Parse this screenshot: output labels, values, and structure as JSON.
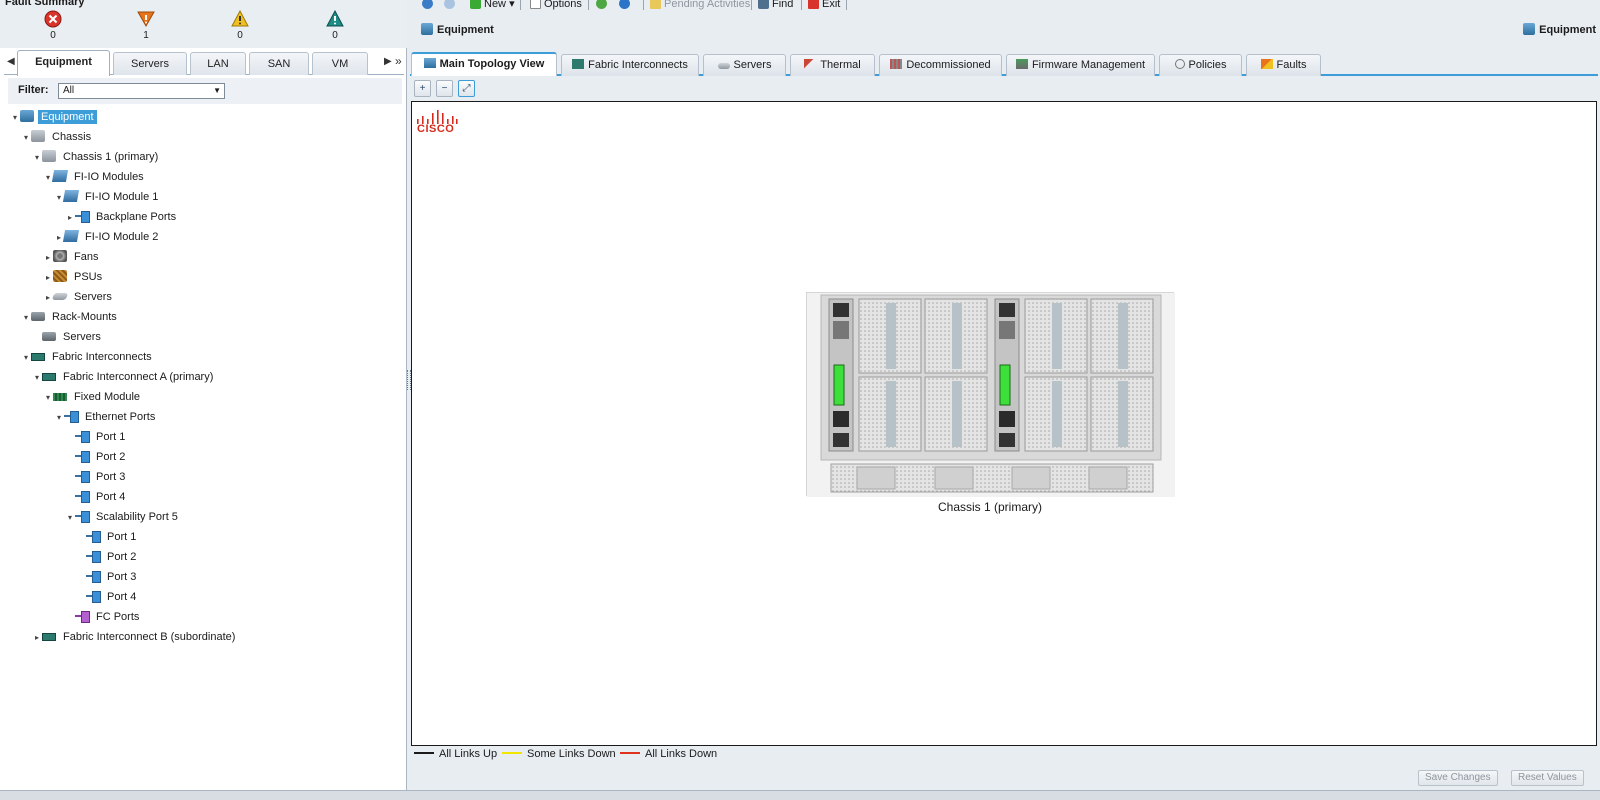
{
  "fault_summary": {
    "title": "Fault Summary",
    "critical": {
      "icon": "critical-x-icon",
      "count": "0",
      "color": "#d9342b"
    },
    "major": {
      "icon": "major-down-triangle-icon",
      "count": "1",
      "color": "#e8731b"
    },
    "minor": {
      "icon": "minor-warning-icon",
      "count": "0",
      "color": "#f0c020"
    },
    "warning": {
      "icon": "warning-teal-icon",
      "count": "0",
      "color": "#1f8b86"
    }
  },
  "nav": {
    "tabs": [
      "Equipment",
      "Servers",
      "LAN",
      "SAN",
      "VM"
    ],
    "active": "Equipment",
    "more_glyph": "»"
  },
  "filter": {
    "label": "Filter:",
    "value": "All"
  },
  "tree": [
    {
      "label": "Equipment",
      "icon": "equipment-icon",
      "twisty": "open",
      "selected": true
    },
    {
      "label": "Chassis",
      "icon": "chassis-icon",
      "twisty": "open"
    },
    {
      "label": "Chassis 1 (primary)",
      "icon": "chassis-icon",
      "twisty": "open"
    },
    {
      "label": "FI-IO Modules",
      "icon": "io-module-icon",
      "twisty": "open"
    },
    {
      "label": "FI-IO Module 1",
      "icon": "io-module-icon",
      "twisty": "open"
    },
    {
      "label": "Backplane Ports",
      "icon": "port-icon",
      "twisty": "closed"
    },
    {
      "label": "FI-IO Module 2",
      "icon": "io-module-icon",
      "twisty": "closed"
    },
    {
      "label": "Fans",
      "icon": "fan-icon",
      "twisty": "closed"
    },
    {
      "label": "PSUs",
      "icon": "psu-icon",
      "twisty": "closed"
    },
    {
      "label": "Servers",
      "icon": "server-icon",
      "twisty": "closed"
    },
    {
      "label": "Rack-Mounts",
      "icon": "rack-icon",
      "twisty": "open"
    },
    {
      "label": "Servers",
      "icon": "rack-icon",
      "twisty": "none"
    },
    {
      "label": "Fabric Interconnects",
      "icon": "fabric-interconnect-icon",
      "twisty": "open"
    },
    {
      "label": "Fabric Interconnect A (primary)",
      "icon": "fabric-interconnect-icon",
      "twisty": "open"
    },
    {
      "label": "Fixed Module",
      "icon": "fixed-module-icon",
      "twisty": "open"
    },
    {
      "label": "Ethernet Ports",
      "icon": "port-icon",
      "twisty": "open"
    },
    {
      "label": "Port 1",
      "icon": "port-icon",
      "twisty": "none"
    },
    {
      "label": "Port 2",
      "icon": "port-icon",
      "twisty": "none"
    },
    {
      "label": "Port 3",
      "icon": "port-icon",
      "twisty": "none"
    },
    {
      "label": "Port 4",
      "icon": "port-icon",
      "twisty": "none"
    },
    {
      "label": "Scalability Port 5",
      "icon": "port-icon",
      "twisty": "open"
    },
    {
      "label": "Port 1",
      "icon": "port-icon",
      "twisty": "none"
    },
    {
      "label": "Port 2",
      "icon": "port-icon",
      "twisty": "none"
    },
    {
      "label": "Port 3",
      "icon": "port-icon",
      "twisty": "none"
    },
    {
      "label": "Port 4",
      "icon": "port-icon",
      "twisty": "none"
    },
    {
      "label": "FC Ports",
      "icon": "fc-port-icon",
      "twisty": "none"
    },
    {
      "label": "Fabric Interconnect B (subordinate)",
      "icon": "fabric-interconnect-icon",
      "twisty": "closed"
    }
  ],
  "toolbar": {
    "new_label": "New",
    "options_label": "Options",
    "pending_label": "Pending Activities",
    "find_label": "Find",
    "exit_label": "Exit"
  },
  "content": {
    "title": "Equipment",
    "title_right": "Equipment"
  },
  "tabs": [
    {
      "label": "Main Topology View",
      "icon": "topology-icon"
    },
    {
      "label": "Fabric Interconnects",
      "icon": "fabric-interconnect-icon"
    },
    {
      "label": "Servers",
      "icon": "server-icon"
    },
    {
      "label": "Thermal",
      "icon": "thermometer-icon"
    },
    {
      "label": "Decommissioned",
      "icon": "decommissioned-icon"
    },
    {
      "label": "Firmware Management",
      "icon": "firmware-icon"
    },
    {
      "label": "Policies",
      "icon": "policy-icon"
    },
    {
      "label": "Faults",
      "icon": "faults-icon"
    }
  ],
  "topology": {
    "logo_text": "CISCO",
    "chassis_label": "Chassis 1 (primary)"
  },
  "legend": [
    {
      "label": "All Links Up",
      "color": "#1a1a1a"
    },
    {
      "label": "Some Links Down",
      "color": "#f2e600"
    },
    {
      "label": "All Links Down",
      "color": "#e0301e"
    }
  ],
  "buttons": {
    "save": "Save Changes",
    "reset": "Reset Values"
  }
}
